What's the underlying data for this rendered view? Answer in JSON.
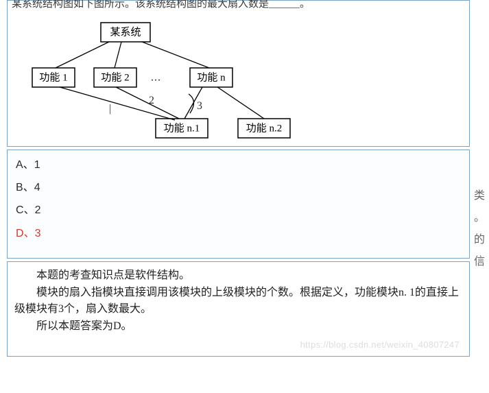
{
  "question": {
    "stem_partial": "某系统结构图如下图所示。该系统结构图的最大扇入数是______。"
  },
  "diagram": {
    "root": "某系统",
    "level1": [
      "功能 1",
      "功能 2",
      "功能 n"
    ],
    "ellipsis": "…",
    "level2": [
      "功能 n.1",
      "功能 n.2"
    ],
    "hand_marks": [
      "2",
      "3"
    ],
    "tick": "|"
  },
  "options": [
    {
      "key": "A",
      "text": "1",
      "correct": false
    },
    {
      "key": "B",
      "text": "4",
      "correct": false
    },
    {
      "key": "C",
      "text": "2",
      "correct": false
    },
    {
      "key": "D",
      "text": "3",
      "correct": true
    }
  ],
  "option_sep": "、",
  "explanation": {
    "line1": "本题的考查知识点是软件结构。",
    "line2": "模块的扇入指模块直接调用该模块的上级模块的个数。根据定义，功能模块n. 1的直接上级模块有3个，扇入数最大。",
    "line3": "所以本题答案为D。"
  },
  "side_fragments": [
    "类",
    "。",
    "的",
    "信"
  ],
  "watermark": "https://blog.csdn.net/weixin_40807247"
}
